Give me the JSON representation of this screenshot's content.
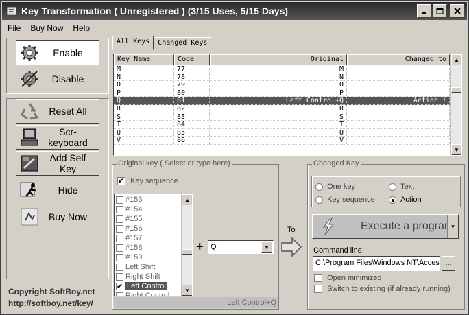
{
  "window": {
    "title": "Key Transformation ( Unregistered ) (3/15 Uses, 5/15 Days)",
    "minimize": "_",
    "maximize": "□",
    "close": "✕"
  },
  "menu": [
    "File",
    "Buy Now",
    "Help"
  ],
  "left_buttons": {
    "enable": "Enable",
    "disable": "Disable",
    "reset_all": "Reset All",
    "scr_keyboard": "Scr-keyboard",
    "add_self_key": "Add Self Key",
    "hide": "Hide",
    "buy_now": "Buy Now"
  },
  "copyright": {
    "line1": "Copyright  SoftBoy.net",
    "line2": "http://softboy.net/key/"
  },
  "tabs": [
    "All Keys",
    "Changed Keys"
  ],
  "key_table": {
    "columns": [
      "Key Name",
      "Code",
      "Original",
      "Changed to"
    ],
    "rows": [
      {
        "name": "M",
        "code": "77",
        "original": "M",
        "changed": ""
      },
      {
        "name": "N",
        "code": "78",
        "original": "N",
        "changed": ""
      },
      {
        "name": "O",
        "code": "79",
        "original": "O",
        "changed": ""
      },
      {
        "name": "P",
        "code": "80",
        "original": "P",
        "changed": ""
      },
      {
        "name": "Q",
        "code": "81",
        "original": "Left Control+Q",
        "changed": "Action !",
        "selected": true
      },
      {
        "name": "R",
        "code": "82",
        "original": "R",
        "changed": ""
      },
      {
        "name": "S",
        "code": "83",
        "original": "S",
        "changed": ""
      },
      {
        "name": "T",
        "code": "84",
        "original": "T",
        "changed": ""
      },
      {
        "name": "U",
        "code": "85",
        "original": "U",
        "changed": ""
      },
      {
        "name": "V",
        "code": "86",
        "original": "V",
        "changed": ""
      }
    ]
  },
  "original_key": {
    "legend": "Original key ( Select or type here)",
    "key_sequence_label": "Key sequence",
    "list": [
      {
        "label": "#153",
        "checked": false
      },
      {
        "label": "#154",
        "checked": false
      },
      {
        "label": "#155",
        "checked": false
      },
      {
        "label": "#156",
        "checked": false
      },
      {
        "label": "#157",
        "checked": false
      },
      {
        "label": "#158",
        "checked": false
      },
      {
        "label": "#159",
        "checked": false
      },
      {
        "label": "Left Shift",
        "checked": false
      },
      {
        "label": "Right Shift",
        "checked": false
      },
      {
        "label": "Left Control",
        "checked": true,
        "selected": true
      },
      {
        "label": "Right Control",
        "checked": false
      }
    ],
    "plus": "+",
    "key_value": "Q",
    "combination": "Left Control+Q"
  },
  "to_label": "To",
  "changed_key": {
    "legend": "Changed Key",
    "options": {
      "one_key": "One key",
      "text": "Text",
      "key_sequence": "Key sequence",
      "action": "Action"
    },
    "selected": "action",
    "action_value": "Execute a program",
    "command_line_label": "Command line:",
    "command_line_value": "C:\\Program Files\\Windows NT\\Accessories\\",
    "browse": "...",
    "open_minimized": "Open minimized",
    "switch_existing": "Switch to existing (if already running)"
  }
}
